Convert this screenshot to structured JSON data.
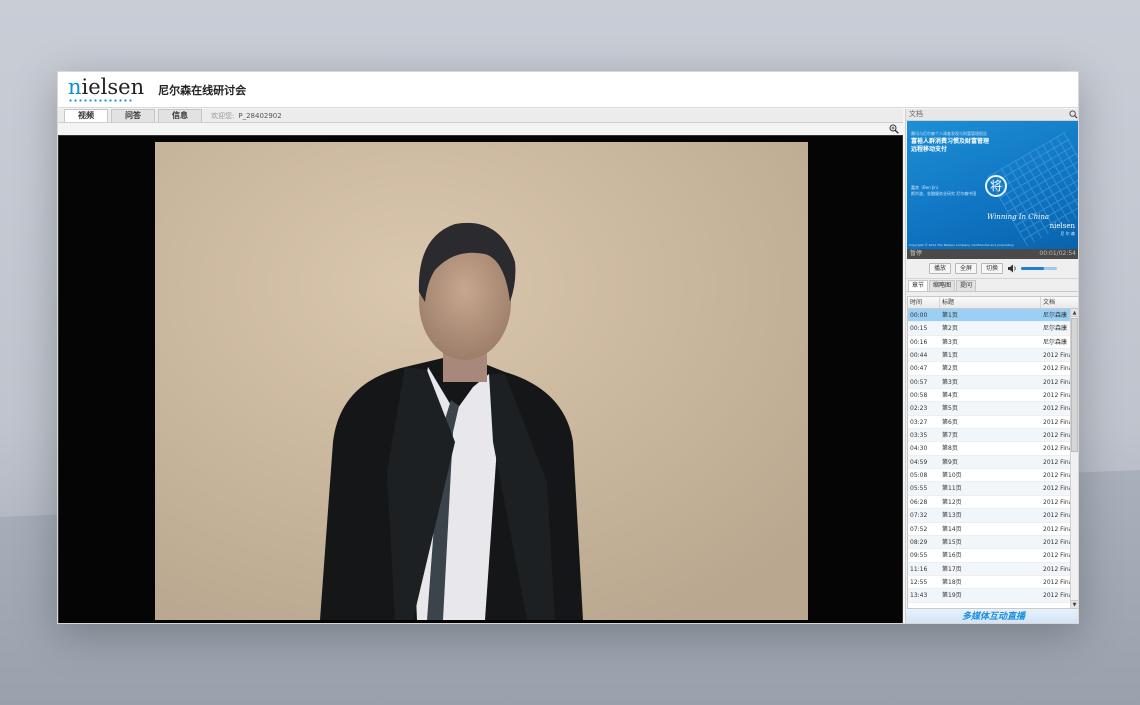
{
  "app": {
    "logo_text": "nielsen",
    "title": "尼尔森在线研讨会"
  },
  "tabs": [
    {
      "label": "视频",
      "active": true
    },
    {
      "label": "问答",
      "active": false
    },
    {
      "label": "信息",
      "active": false
    }
  ],
  "welcome": {
    "label": "欢迎您:",
    "user": "P_28402902"
  },
  "doc_panel": {
    "header": "文档",
    "slide": {
      "subtitle": "腾讯与尼尔森个人调查发现与财富管理报告",
      "title_line1": "富裕人群消费习惯及财富管理",
      "title_line2": "远程移动支付",
      "info": "嘉宾（Ben Jin）\n斯尔波、金融服务业研究  尼尔森中国",
      "stamp": "将",
      "handwriting": "Winning In China",
      "logo": "nielsen",
      "logo_sub": "尼 尔 森",
      "footer": "Copyright © 2012 The Nielsen Company. Confidential and proprietary."
    }
  },
  "player": {
    "status": "暂停",
    "time": "00:01/02:54",
    "buttons": {
      "play": "播放",
      "fullscreen": "全屏",
      "switch": "切换"
    },
    "volume": 0.65
  },
  "sub_tabs": [
    {
      "label": "章节",
      "active": true
    },
    {
      "label": "缩略图",
      "active": false
    },
    {
      "label": "提问",
      "active": false
    }
  ],
  "chapters": {
    "columns": {
      "time": "时间",
      "title": "标题",
      "doc": "文档"
    },
    "rows": [
      {
        "time": "00:00",
        "title": "第1页",
        "doc": "尼尔森康",
        "selected": true
      },
      {
        "time": "00:15",
        "title": "第2页",
        "doc": "尼尔森康"
      },
      {
        "time": "00:16",
        "title": "第3页",
        "doc": "尼尔森康"
      },
      {
        "time": "00:44",
        "title": "第1页",
        "doc": "2012 Fina"
      },
      {
        "time": "00:47",
        "title": "第2页",
        "doc": "2012 Fina"
      },
      {
        "time": "00:57",
        "title": "第3页",
        "doc": "2012 Fina"
      },
      {
        "time": "00:58",
        "title": "第4页",
        "doc": "2012 Fina"
      },
      {
        "time": "02:23",
        "title": "第5页",
        "doc": "2012 Fina"
      },
      {
        "time": "03:27",
        "title": "第6页",
        "doc": "2012 Fina"
      },
      {
        "time": "03:35",
        "title": "第7页",
        "doc": "2012 Fina"
      },
      {
        "time": "04:30",
        "title": "第8页",
        "doc": "2012 Fina"
      },
      {
        "time": "04:59",
        "title": "第9页",
        "doc": "2012 Fina"
      },
      {
        "time": "05:08",
        "title": "第10页",
        "doc": "2012 Fina"
      },
      {
        "time": "05:55",
        "title": "第11页",
        "doc": "2012 Fina"
      },
      {
        "time": "06:28",
        "title": "第12页",
        "doc": "2012 Fina"
      },
      {
        "time": "07:32",
        "title": "第13页",
        "doc": "2012 Fina"
      },
      {
        "time": "07:52",
        "title": "第14页",
        "doc": "2012 Fina"
      },
      {
        "time": "08:29",
        "title": "第15页",
        "doc": "2012 Fina"
      },
      {
        "time": "09:55",
        "title": "第16页",
        "doc": "2012 Fina"
      },
      {
        "time": "11:16",
        "title": "第17页",
        "doc": "2012 Fina"
      },
      {
        "time": "12:55",
        "title": "第18页",
        "doc": "2012 Fina"
      },
      {
        "time": "13:43",
        "title": "第19页",
        "doc": "2012 Fina"
      }
    ]
  },
  "footer_banner": "多媒体互动直播",
  "icons": {
    "zoom": "zoom-in-icon",
    "speaker": "speaker-icon"
  },
  "colors": {
    "accent": "#0a8fd0",
    "selected_row": "#9bd0f5",
    "banner_text": "#1a8ee0"
  }
}
